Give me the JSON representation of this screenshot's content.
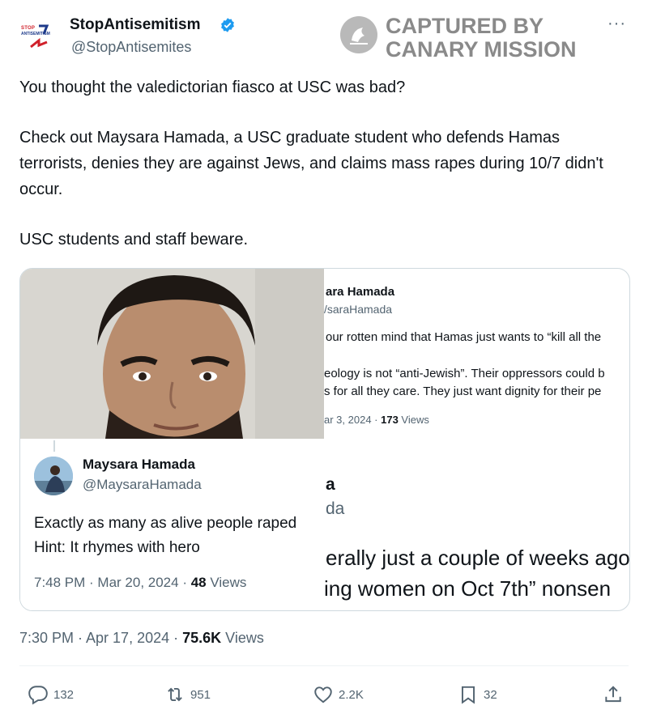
{
  "author": {
    "name": "StopAntisemitism",
    "handle": "@StopAntisemites",
    "avatar_text": [
      "STOP",
      "ANTISEMITISM"
    ]
  },
  "watermark": {
    "line1": "CAPTURED BY",
    "line2": "CANARY MISSION"
  },
  "more_label": "···",
  "tweet": {
    "paragraphs": [
      "You thought the valedictorian fiasco at USC was bad?",
      "Check out Maysara Hamada, a USC graduate student who defends Hamas terrorists, denies they are against Jews, and claims mass rapes during 10/7 didn't occur.",
      "USC students and staff beware."
    ]
  },
  "media": {
    "right_screenshot": {
      "name": "ara Hamada",
      "handle": "/saraHamada",
      "line1": "our rotten mind that Hamas just wants to “kill all the",
      "line2": "eology is not “anti-Jewish”. Their oppressors could b",
      "line3": "s for all they care. They just want dignity for their pe",
      "meta_date": "ar 3, 2024 · ",
      "meta_views_count": "173",
      "meta_views_label": " Views",
      "big1": "a",
      "big2": "da",
      "big3": "erally just a couple of weeks ago",
      "big4": "ing women on Oct 7th” nonsen"
    },
    "quote": {
      "name": "Maysara Hamada",
      "handle": "@MaysaraHamada",
      "line1": "Exactly as many as alive people raped",
      "line2": "Hint: It rhymes with hero",
      "meta_time": "7:48 PM · Mar 20, 2024 · ",
      "meta_views_count": "48",
      "meta_views_label": " Views"
    }
  },
  "timestamp": {
    "time": "7:30 PM · Apr 17, 2024 · ",
    "views_count": "75.6K",
    "views_label": " Views"
  },
  "actions": {
    "replies": "132",
    "retweets": "951",
    "likes": "2.2K",
    "bookmarks": "32"
  },
  "colors": {
    "text": "#0f1419",
    "secondary": "#536471",
    "verified": "#1d9bf0",
    "border": "#cfd9de",
    "watermark": "#8a8a8a"
  },
  "icons": [
    "verified-badge-icon",
    "more-icon",
    "canary-logo-icon",
    "reply-icon",
    "retweet-icon",
    "like-icon",
    "bookmark-icon",
    "share-icon"
  ]
}
